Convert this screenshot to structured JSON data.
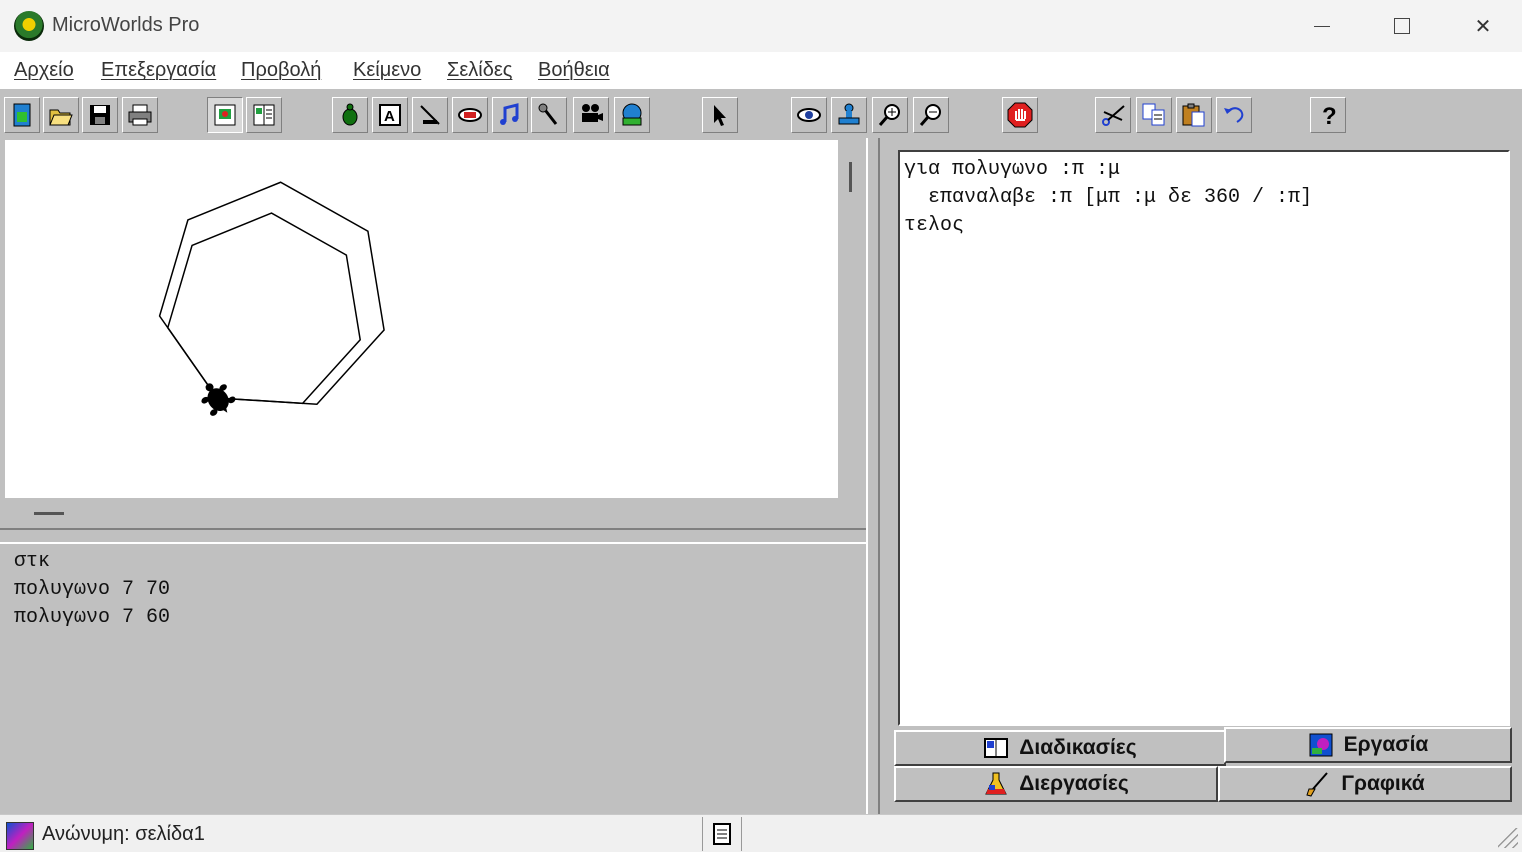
{
  "window": {
    "title": "MicroWorlds Pro"
  },
  "menu": [
    "Αρχείο",
    "Επεξεργασία",
    "Προβολή",
    "Κείμενο",
    "Σελίδες",
    "Βοήθεια"
  ],
  "toolbar": {
    "icons": [
      "new-icon",
      "open-icon",
      "save-icon",
      "print-icon",
      "graphics-view-icon",
      "split-view-icon",
      "turtle-icon",
      "text-box-icon",
      "slider-icon",
      "button-icon",
      "music-icon",
      "sound-icon",
      "video-icon",
      "hatch-turtle-icon",
      "pointer-icon",
      "eye-icon",
      "stamp-icon",
      "zoom-in-icon",
      "zoom-out-icon",
      "stop-icon",
      "cut-icon",
      "copy-icon",
      "paste-icon",
      "undo-icon",
      "help-icon"
    ]
  },
  "command_center": {
    "lines": [
      "στκ",
      "πολυγωνο 7 70",
      "πολυγωνο 7 60"
    ]
  },
  "procedures": {
    "lines": [
      "για πολυγωνο :π :μ",
      "  επαναλαβε :π [μπ :μ δε 360 / :π]",
      "τελος"
    ]
  },
  "tabs": {
    "procedures": "Διαδικασίες",
    "project": "Εργασία",
    "processes": "Διεργασίες",
    "graphics": "Γραφικά"
  },
  "status": {
    "text": "Ανώνυμη:  σελίδα1"
  },
  "drawing": {
    "polygons": [
      {
        "sides": 7,
        "length": 70
      },
      {
        "sides": 7,
        "length": 60
      }
    ],
    "stroke": "#000000"
  }
}
